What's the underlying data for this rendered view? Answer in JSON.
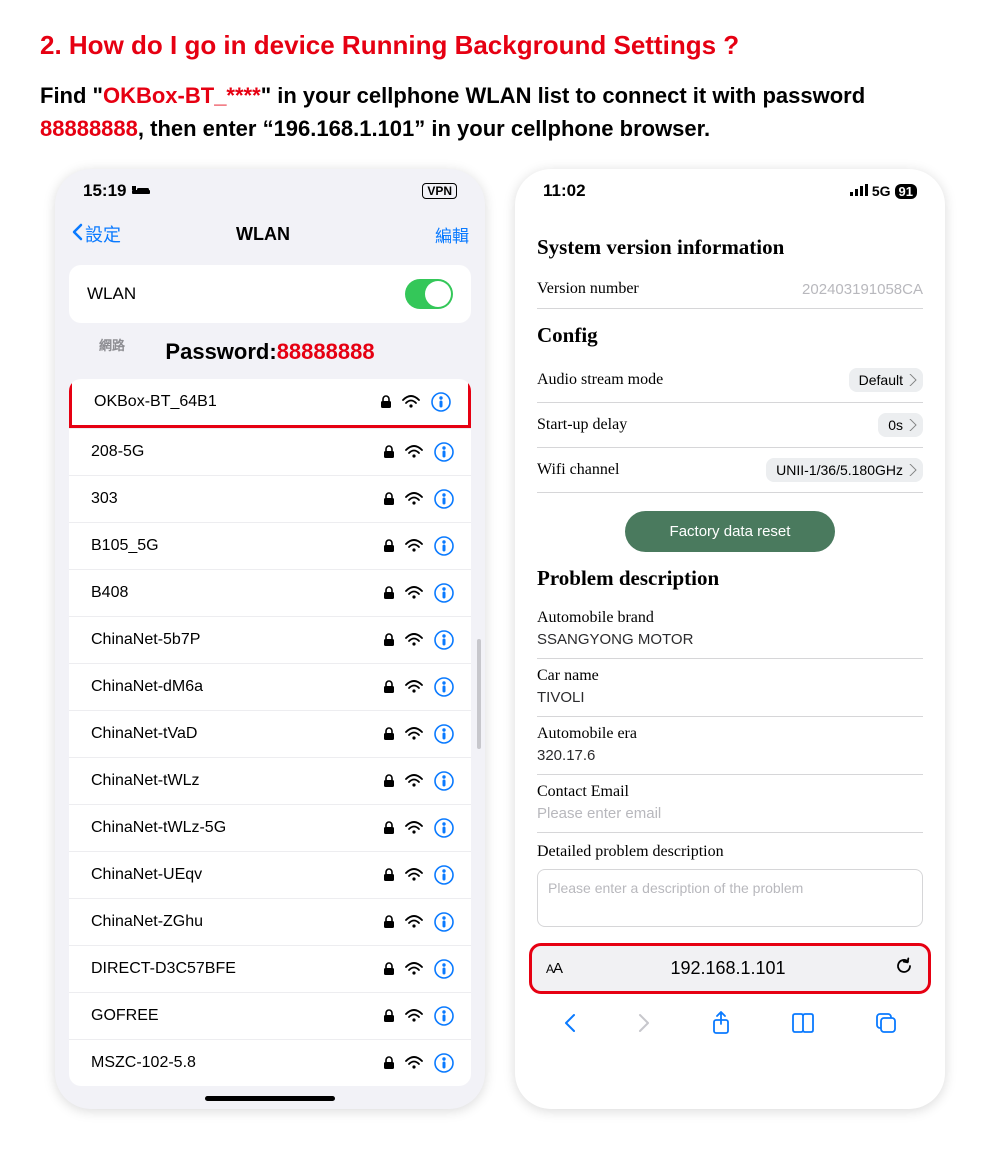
{
  "heading": "2. How do I go in device Running Background Settings ?",
  "instruction": {
    "part1": "Find \"",
    "ssid_pattern": "OKBox-BT_****",
    "part2": "\" in your cellphone WLAN list to connect it with password ",
    "password": "88888888",
    "part3": ", then enter “196.168.1.101” in your cellphone browser."
  },
  "left": {
    "time": "15:19",
    "vpn": "VPN",
    "back_label": "設定",
    "title": "WLAN",
    "edit_label": "編輯",
    "wlan_label": "WLAN",
    "password_prefix": "Password:",
    "password_value": "88888888",
    "section_label": "網路",
    "networks": [
      "OKBox-BT_64B1",
      "208-5G",
      "303",
      "B105_5G",
      "B408",
      "ChinaNet-5b7P",
      "ChinaNet-dM6a",
      "ChinaNet-tVaD",
      "ChinaNet-tWLz",
      "ChinaNet-tWLz-5G",
      "ChinaNet-UEqv",
      "ChinaNet-ZGhu",
      "DIRECT-D3C57BFE",
      "GOFREE",
      "MSZC-102-5.8"
    ]
  },
  "right": {
    "time": "11:02",
    "network_type": "5G",
    "battery": "91",
    "sysver_heading": "System version information",
    "version_label": "Version number",
    "version_value": "202403191058CA",
    "config_heading": "Config",
    "audio_label": "Audio stream mode",
    "audio_value": "Default",
    "startup_label": "Start-up delay",
    "startup_value": "0s",
    "wifi_ch_label": "Wifi channel",
    "wifi_ch_value": "UNII-1/36/5.180GHz",
    "factory_btn": "Factory data reset",
    "problem_heading": "Problem description",
    "brand_label": "Automobile brand",
    "brand_value": "SSANGYONG MOTOR",
    "car_label": "Car name",
    "car_value": "TIVOLI",
    "era_label": "Automobile era",
    "era_value": "320.17.6",
    "email_label": "Contact Email",
    "email_placeholder": "Please enter email",
    "detail_label": "Detailed problem description",
    "detail_placeholder": "Please enter a description of the problem",
    "url": "192.168.1.101"
  }
}
